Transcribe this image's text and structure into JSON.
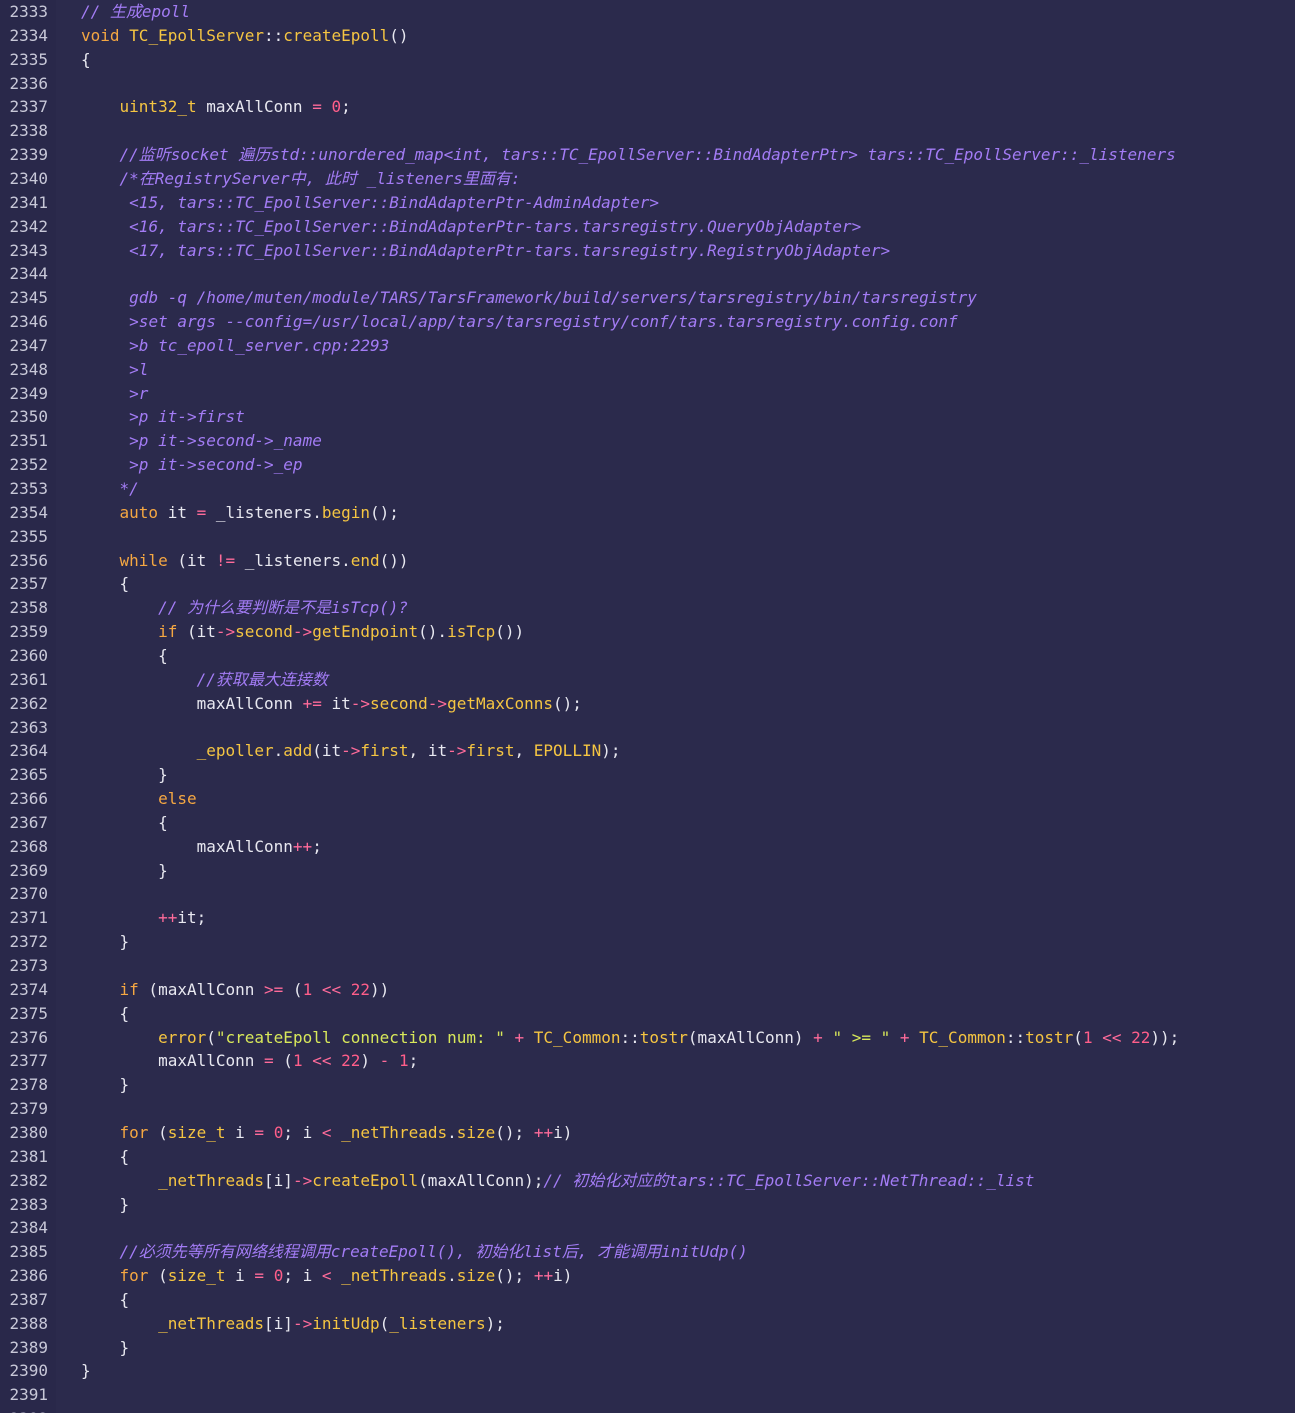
{
  "editor": {
    "first_line": 2333,
    "lines": [
      {
        "n": "2333",
        "tokens": [
          [
            "cm",
            "// 生成epoll"
          ]
        ]
      },
      {
        "n": "2334",
        "tokens": [
          [
            "kw",
            "void"
          ],
          [
            "pl",
            " "
          ],
          [
            "ty",
            "TC_EpollServer"
          ],
          [
            "pl",
            "::"
          ],
          [
            "fn",
            "createEpoll"
          ],
          [
            "pl",
            "()"
          ]
        ]
      },
      {
        "n": "2335",
        "tokens": [
          [
            "pl",
            "{"
          ]
        ]
      },
      {
        "n": "2336",
        "tokens": []
      },
      {
        "n": "2337",
        "tokens": [
          [
            "pl",
            "    "
          ],
          [
            "ty",
            "uint32_t"
          ],
          [
            "pl",
            " maxAllConn "
          ],
          [
            "op",
            "="
          ],
          [
            "pl",
            " "
          ],
          [
            "num",
            "0"
          ],
          [
            "pl",
            ";"
          ]
        ]
      },
      {
        "n": "2338",
        "tokens": []
      },
      {
        "n": "2339",
        "tokens": [
          [
            "pl",
            "    "
          ],
          [
            "cm",
            "//监听socket 遍历std::unordered_map<int, tars::TC_EpollServer::BindAdapterPtr> tars::TC_EpollServer::_listeners"
          ]
        ]
      },
      {
        "n": "2340",
        "tokens": [
          [
            "pl",
            "    "
          ],
          [
            "cm",
            "/*在RegistryServer中, 此时 _listeners里面有:"
          ]
        ]
      },
      {
        "n": "2341",
        "tokens": [
          [
            "pl",
            "     "
          ],
          [
            "cm",
            "<15, tars::TC_EpollServer::BindAdapterPtr-AdminAdapter>"
          ]
        ]
      },
      {
        "n": "2342",
        "tokens": [
          [
            "pl",
            "     "
          ],
          [
            "cm",
            "<16, tars::TC_EpollServer::BindAdapterPtr-tars.tarsregistry.QueryObjAdapter>"
          ]
        ]
      },
      {
        "n": "2343",
        "tokens": [
          [
            "pl",
            "     "
          ],
          [
            "cm",
            "<17, tars::TC_EpollServer::BindAdapterPtr-tars.tarsregistry.RegistryObjAdapter>"
          ]
        ]
      },
      {
        "n": "2344",
        "tokens": []
      },
      {
        "n": "2345",
        "tokens": [
          [
            "pl",
            "     "
          ],
          [
            "cm",
            "gdb -q /home/muten/module/TARS/TarsFramework/build/servers/tarsregistry/bin/tarsregistry"
          ]
        ]
      },
      {
        "n": "2346",
        "tokens": [
          [
            "pl",
            "     "
          ],
          [
            "cm",
            ">set args --config=/usr/local/app/tars/tarsregistry/conf/tars.tarsregistry.config.conf"
          ]
        ]
      },
      {
        "n": "2347",
        "tokens": [
          [
            "pl",
            "     "
          ],
          [
            "cm",
            ">b tc_epoll_server.cpp:2293"
          ]
        ]
      },
      {
        "n": "2348",
        "tokens": [
          [
            "pl",
            "     "
          ],
          [
            "cm",
            ">l"
          ]
        ]
      },
      {
        "n": "2349",
        "tokens": [
          [
            "pl",
            "     "
          ],
          [
            "cm",
            ">r"
          ]
        ]
      },
      {
        "n": "2350",
        "tokens": [
          [
            "pl",
            "     "
          ],
          [
            "cm",
            ">p it->first"
          ]
        ]
      },
      {
        "n": "2351",
        "tokens": [
          [
            "pl",
            "     "
          ],
          [
            "cm",
            ">p it->second->_name"
          ]
        ]
      },
      {
        "n": "2352",
        "tokens": [
          [
            "pl",
            "     "
          ],
          [
            "cm",
            ">p it->second->_ep"
          ]
        ]
      },
      {
        "n": "2353",
        "tokens": [
          [
            "pl",
            "    "
          ],
          [
            "cm",
            "*/"
          ]
        ]
      },
      {
        "n": "2354",
        "tokens": [
          [
            "pl",
            "    "
          ],
          [
            "kw",
            "auto"
          ],
          [
            "pl",
            " it "
          ],
          [
            "op",
            "="
          ],
          [
            "pl",
            " _listeners."
          ],
          [
            "fn",
            "begin"
          ],
          [
            "pl",
            "();"
          ]
        ]
      },
      {
        "n": "2355",
        "tokens": []
      },
      {
        "n": "2356",
        "tokens": [
          [
            "pl",
            "    "
          ],
          [
            "kw",
            "while"
          ],
          [
            "pl",
            " (it "
          ],
          [
            "op",
            "!="
          ],
          [
            "pl",
            " _listeners."
          ],
          [
            "fn",
            "end"
          ],
          [
            "pl",
            "())"
          ]
        ]
      },
      {
        "n": "2357",
        "tokens": [
          [
            "pl",
            "    {"
          ]
        ]
      },
      {
        "n": "2358",
        "tokens": [
          [
            "pl",
            "        "
          ],
          [
            "cm",
            "// 为什么要判断是不是isTcp()?"
          ]
        ]
      },
      {
        "n": "2359",
        "tokens": [
          [
            "pl",
            "        "
          ],
          [
            "kw",
            "if"
          ],
          [
            "pl",
            " (it"
          ],
          [
            "op",
            "->"
          ],
          [
            "mem",
            "second"
          ],
          [
            "op",
            "->"
          ],
          [
            "fn",
            "getEndpoint"
          ],
          [
            "pl",
            "()."
          ],
          [
            "fn",
            "isTcp"
          ],
          [
            "pl",
            "())"
          ]
        ]
      },
      {
        "n": "2360",
        "tokens": [
          [
            "pl",
            "        {"
          ]
        ]
      },
      {
        "n": "2361",
        "tokens": [
          [
            "pl",
            "            "
          ],
          [
            "cm",
            "//获取最大连接数"
          ]
        ]
      },
      {
        "n": "2362",
        "tokens": [
          [
            "pl",
            "            maxAllConn "
          ],
          [
            "op",
            "+="
          ],
          [
            "pl",
            " it"
          ],
          [
            "op",
            "->"
          ],
          [
            "mem",
            "second"
          ],
          [
            "op",
            "->"
          ],
          [
            "fn",
            "getMaxConns"
          ],
          [
            "pl",
            "();"
          ]
        ]
      },
      {
        "n": "2363",
        "tokens": []
      },
      {
        "n": "2364",
        "tokens": [
          [
            "pl",
            "            "
          ],
          [
            "mem",
            "_epoller"
          ],
          [
            "pl",
            "."
          ],
          [
            "fn",
            "add"
          ],
          [
            "pl",
            "(it"
          ],
          [
            "op",
            "->"
          ],
          [
            "mem",
            "first"
          ],
          [
            "pl",
            ", it"
          ],
          [
            "op",
            "->"
          ],
          [
            "mem",
            "first"
          ],
          [
            "pl",
            ", "
          ],
          [
            "cn",
            "EPOLLIN"
          ],
          [
            "pl",
            ");"
          ]
        ]
      },
      {
        "n": "2365",
        "tokens": [
          [
            "pl",
            "        }"
          ]
        ]
      },
      {
        "n": "2366",
        "tokens": [
          [
            "pl",
            "        "
          ],
          [
            "kw",
            "else"
          ]
        ]
      },
      {
        "n": "2367",
        "tokens": [
          [
            "pl",
            "        {"
          ]
        ]
      },
      {
        "n": "2368",
        "tokens": [
          [
            "pl",
            "            maxAllConn"
          ],
          [
            "op",
            "++"
          ],
          [
            "pl",
            ";"
          ]
        ]
      },
      {
        "n": "2369",
        "tokens": [
          [
            "pl",
            "        }"
          ]
        ]
      },
      {
        "n": "2370",
        "tokens": []
      },
      {
        "n": "2371",
        "tokens": [
          [
            "pl",
            "        "
          ],
          [
            "op",
            "++"
          ],
          [
            "pl",
            "it;"
          ]
        ]
      },
      {
        "n": "2372",
        "tokens": [
          [
            "pl",
            "    }"
          ]
        ]
      },
      {
        "n": "2373",
        "tokens": []
      },
      {
        "n": "2374",
        "tokens": [
          [
            "pl",
            "    "
          ],
          [
            "kw",
            "if"
          ],
          [
            "pl",
            " (maxAllConn "
          ],
          [
            "op",
            ">="
          ],
          [
            "pl",
            " ("
          ],
          [
            "num",
            "1"
          ],
          [
            "pl",
            " "
          ],
          [
            "op",
            "<<"
          ],
          [
            "pl",
            " "
          ],
          [
            "num",
            "22"
          ],
          [
            "pl",
            "))"
          ]
        ]
      },
      {
        "n": "2375",
        "tokens": [
          [
            "pl",
            "    {"
          ]
        ]
      },
      {
        "n": "2376",
        "tokens": [
          [
            "pl",
            "        "
          ],
          [
            "fn",
            "error"
          ],
          [
            "pl",
            "("
          ],
          [
            "str",
            "\"createEpoll connection num: \""
          ],
          [
            "pl",
            " "
          ],
          [
            "op",
            "+"
          ],
          [
            "pl",
            " "
          ],
          [
            "ns",
            "TC_Common"
          ],
          [
            "pl",
            "::"
          ],
          [
            "fn",
            "tostr"
          ],
          [
            "pl",
            "(maxAllConn) "
          ],
          [
            "op",
            "+"
          ],
          [
            "pl",
            " "
          ],
          [
            "str",
            "\" >= \""
          ],
          [
            "pl",
            " "
          ],
          [
            "op",
            "+"
          ],
          [
            "pl",
            " "
          ],
          [
            "ns",
            "TC_Common"
          ],
          [
            "pl",
            "::"
          ],
          [
            "fn",
            "tostr"
          ],
          [
            "pl",
            "("
          ],
          [
            "num",
            "1"
          ],
          [
            "pl",
            " "
          ],
          [
            "op",
            "<<"
          ],
          [
            "pl",
            " "
          ],
          [
            "num",
            "22"
          ],
          [
            "pl",
            "));"
          ]
        ]
      },
      {
        "n": "2377",
        "tokens": [
          [
            "pl",
            "        maxAllConn "
          ],
          [
            "op",
            "="
          ],
          [
            "pl",
            " ("
          ],
          [
            "num",
            "1"
          ],
          [
            "pl",
            " "
          ],
          [
            "op",
            "<<"
          ],
          [
            "pl",
            " "
          ],
          [
            "num",
            "22"
          ],
          [
            "pl",
            ") "
          ],
          [
            "op",
            "-"
          ],
          [
            "pl",
            " "
          ],
          [
            "num",
            "1"
          ],
          [
            "pl",
            ";"
          ]
        ]
      },
      {
        "n": "2378",
        "tokens": [
          [
            "pl",
            "    }"
          ]
        ]
      },
      {
        "n": "2379",
        "tokens": []
      },
      {
        "n": "2380",
        "tokens": [
          [
            "pl",
            "    "
          ],
          [
            "kw",
            "for"
          ],
          [
            "pl",
            " ("
          ],
          [
            "ty",
            "size_t"
          ],
          [
            "pl",
            " i "
          ],
          [
            "op",
            "="
          ],
          [
            "pl",
            " "
          ],
          [
            "num",
            "0"
          ],
          [
            "pl",
            "; i "
          ],
          [
            "op",
            "<"
          ],
          [
            "pl",
            " "
          ],
          [
            "mem",
            "_netThreads"
          ],
          [
            "pl",
            "."
          ],
          [
            "fn",
            "size"
          ],
          [
            "pl",
            "(); "
          ],
          [
            "op",
            "++"
          ],
          [
            "pl",
            "i)"
          ]
        ]
      },
      {
        "n": "2381",
        "tokens": [
          [
            "pl",
            "    {"
          ]
        ]
      },
      {
        "n": "2382",
        "tokens": [
          [
            "pl",
            "        "
          ],
          [
            "mem",
            "_netThreads"
          ],
          [
            "pl",
            "[i]"
          ],
          [
            "op",
            "->"
          ],
          [
            "fn",
            "createEpoll"
          ],
          [
            "pl",
            "(maxAllConn);"
          ],
          [
            "cm",
            "// 初始化对应的tars::TC_EpollServer::NetThread::_list"
          ]
        ]
      },
      {
        "n": "2383",
        "tokens": [
          [
            "pl",
            "    }"
          ]
        ]
      },
      {
        "n": "2384",
        "tokens": []
      },
      {
        "n": "2385",
        "tokens": [
          [
            "pl",
            "    "
          ],
          [
            "cm",
            "//必须先等所有网络线程调用createEpoll(), 初始化list后, 才能调用initUdp()"
          ]
        ]
      },
      {
        "n": "2386",
        "tokens": [
          [
            "pl",
            "    "
          ],
          [
            "kw",
            "for"
          ],
          [
            "pl",
            " ("
          ],
          [
            "ty",
            "size_t"
          ],
          [
            "pl",
            " i "
          ],
          [
            "op",
            "="
          ],
          [
            "pl",
            " "
          ],
          [
            "num",
            "0"
          ],
          [
            "pl",
            "; i "
          ],
          [
            "op",
            "<"
          ],
          [
            "pl",
            " "
          ],
          [
            "mem",
            "_netThreads"
          ],
          [
            "pl",
            "."
          ],
          [
            "fn",
            "size"
          ],
          [
            "pl",
            "(); "
          ],
          [
            "op",
            "++"
          ],
          [
            "pl",
            "i)"
          ]
        ]
      },
      {
        "n": "2387",
        "tokens": [
          [
            "pl",
            "    {"
          ]
        ]
      },
      {
        "n": "2388",
        "tokens": [
          [
            "pl",
            "        "
          ],
          [
            "mem",
            "_netThreads"
          ],
          [
            "pl",
            "[i]"
          ],
          [
            "op",
            "->"
          ],
          [
            "fn",
            "initUdp"
          ],
          [
            "pl",
            "("
          ],
          [
            "mem",
            "_listeners"
          ],
          [
            "pl",
            ");"
          ]
        ]
      },
      {
        "n": "2389",
        "tokens": [
          [
            "pl",
            "    }"
          ]
        ]
      },
      {
        "n": "2390",
        "tokens": [
          [
            "pl",
            "}"
          ]
        ]
      },
      {
        "n": "2391",
        "tokens": []
      },
      {
        "n": "2392",
        "tokens": []
      }
    ]
  }
}
